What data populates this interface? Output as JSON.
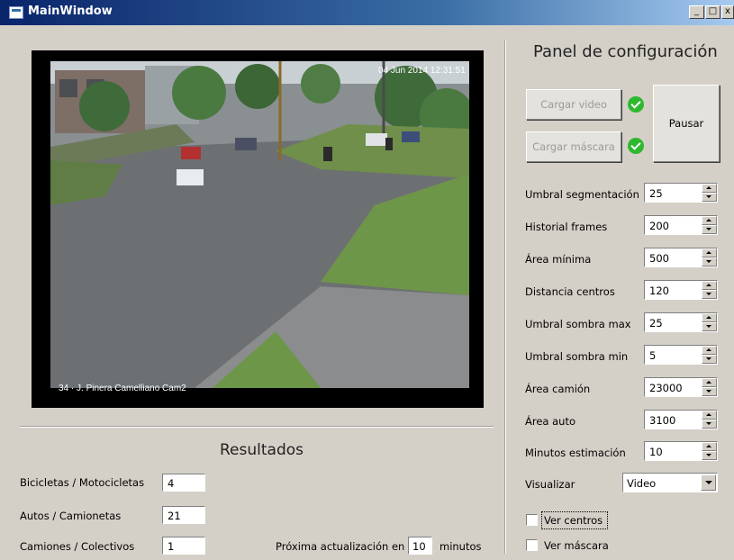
{
  "window": {
    "title": "MainWindow",
    "controls": [
      "_",
      "□",
      "x"
    ]
  },
  "video": {
    "timestamp": "04 Jun 2014  12:31:51",
    "caption": "34 · J. Pinera Camelliano Cam2"
  },
  "config_panel": {
    "title": "Panel de configuración",
    "load_video_label": "Cargar video",
    "load_mask_label": "Cargar máscara",
    "pause_label": "Pausar",
    "fields": [
      {
        "label": "Umbral segmentación",
        "value": "25"
      },
      {
        "label": "Historial frames",
        "value": "200"
      },
      {
        "label": "Área mínima",
        "value": "500"
      },
      {
        "label": "Distancia centros",
        "value": "120"
      },
      {
        "label": "Umbral sombra max",
        "value": "25"
      },
      {
        "label": "Umbral sombra min",
        "value": "5"
      },
      {
        "label": "Área camión",
        "value": "23000"
      },
      {
        "label": "Área auto",
        "value": "3100"
      },
      {
        "label": "Minutos estimación",
        "value": "10"
      }
    ],
    "visualize_label": "Visualizar",
    "visualize_value": "Video",
    "show_centers_label": "Ver centros",
    "show_mask_label": "Ver máscara"
  },
  "results": {
    "title": "Resultados",
    "rows": [
      {
        "label": "Bicicletas / Motocicletas",
        "value": "4"
      },
      {
        "label": "Autos / Camionetas",
        "value": "21"
      },
      {
        "label": "Camiones / Colectivos",
        "value": "1"
      }
    ],
    "next_update_label": "Próxima actualización en",
    "next_update_value": "10",
    "minutes_label": "minutos"
  },
  "colors": {
    "ok_check": "#2eb82e",
    "titlebar": "#0a246a"
  }
}
